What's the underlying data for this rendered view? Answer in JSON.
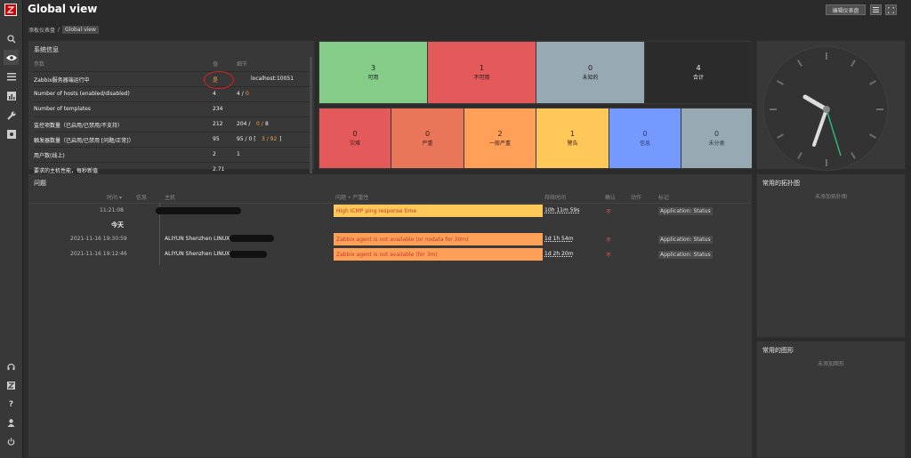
{
  "header": {
    "title": "Global view",
    "edit_button": "编辑仪表盘"
  },
  "breadcrumb": {
    "parent": "添板仪表盘",
    "current": "Global view"
  },
  "system_info": {
    "title": "系统信息",
    "headers": {
      "param": "参数",
      "value": "值",
      "details": "细节"
    },
    "rows": [
      {
        "param": "Zabbix服务器端运行中",
        "value": "是",
        "details": "localhost:10051",
        "d2": "",
        "d3": ""
      },
      {
        "param": "Number of hosts (enabled/disabled)",
        "value": "4",
        "details": "4 /",
        "d2": "0",
        "d3": ""
      },
      {
        "param": "Number of templates",
        "value": "234",
        "details": "",
        "d2": "",
        "d3": ""
      },
      {
        "param": "监控项数量（已启用/已禁用/不支持）",
        "value": "212",
        "details": "204 /",
        "d2": "0 /",
        "d3": "8"
      },
      {
        "param": "触发器数量（已启用/已禁用 [问题/正常]）",
        "value": "95",
        "details": "95 / 0 [",
        "d2": "3 / 92",
        "d3": "]"
      },
      {
        "param": "用户数(线上)",
        "value": "2",
        "details": "1",
        "d2": "",
        "d3": ""
      },
      {
        "param": "要求的主机性能，每秒新值",
        "value": "2.71",
        "details": "",
        "d2": "",
        "d3": ""
      }
    ]
  },
  "host_avail": [
    {
      "count": "3",
      "label": "可用"
    },
    {
      "count": "1",
      "label": "不可用"
    },
    {
      "count": "0",
      "label": "未知的"
    },
    {
      "count": "4",
      "label": "合计"
    }
  ],
  "severity": [
    {
      "count": "0",
      "label": "灾难"
    },
    {
      "count": "0",
      "label": "严重"
    },
    {
      "count": "2",
      "label": "一般严重"
    },
    {
      "count": "1",
      "label": "警告"
    },
    {
      "count": "0",
      "label": "信息"
    },
    {
      "count": "0",
      "label": "未分类"
    }
  ],
  "problems": {
    "title": "问题",
    "headers": {
      "time": "时间 ▾",
      "info": "信息",
      "host": "主机",
      "problem": "问题 • 严重性",
      "duration": "持续时间",
      "ack": "确认",
      "actions": "动作",
      "tags": "标记"
    },
    "today": "今天",
    "rows": [
      {
        "time": "11:21:08",
        "host": "",
        "problem": "High ICMP ping response time",
        "duration": "10h 11m 59s",
        "ack": "不",
        "tag": "Application: Status"
      },
      {
        "time": "2021-11-16 19:30:59",
        "host": "ALIYUN Shenzhen LINUX",
        "problem": "Zabbix agent is not available (or nodata for 30m)",
        "duration": "1d 1h 54m",
        "ack": "不",
        "tag": "Application: Status"
      },
      {
        "time": "2021-11-16 19:12:46",
        "host": "ALIYUN Shenzhen LINUX",
        "problem": "Zabbix agent is not available (for 3m)",
        "duration": "1d 2h 20m",
        "ack": "不",
        "tag": "Application: Status"
      }
    ]
  },
  "fav_maps": {
    "title": "常用的拓扑图",
    "empty": "未添加拓扑图"
  },
  "fav_graphs": {
    "title": "常用的图形",
    "empty": "未添加图形"
  },
  "colors": {
    "available": "#86cc89",
    "unavailable": "#e45959",
    "unknown": "#97aab3",
    "disaster": "#e45959",
    "high": "#e97659",
    "average": "#ffa059",
    "warning": "#ffc859",
    "info": "#7499ff",
    "notclassified": "#97aab3"
  }
}
